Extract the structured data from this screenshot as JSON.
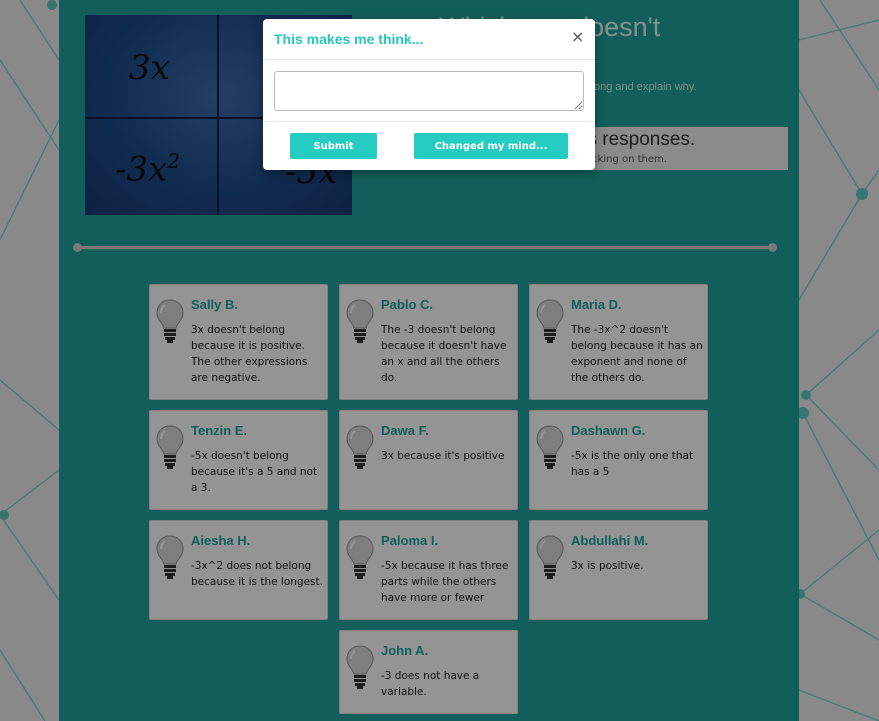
{
  "page": {
    "title": "Which one doesn't",
    "instructions": "Choose the one that doesn't belong and explain why.",
    "intro_heading": "Teacher animates responses.",
    "intro_sub": "You can see their ideas by clicking on them.",
    "expressions": [
      "3x",
      "-3x",
      "-5x",
      "2"
    ]
  },
  "responses": [
    {
      "name": "Sally B.",
      "text": "3x doesn't belong because it is positive. The other expressions are negative."
    },
    {
      "name": "Pablo C.",
      "text": "The -3 doesn't belong because it doesn't have an x and all the others do."
    },
    {
      "name": "Maria D.",
      "text": "The -3x^2 doesn't belong because it has an exponent and none of the others do."
    },
    {
      "name": "Tenzin E.",
      "text": "-5x doesn't belong because it's a 5 and not a 3."
    },
    {
      "name": "Dawa F.",
      "text": "3x because it's positive"
    },
    {
      "name": "Dashawn G.",
      "text": "-5x is the only one that has a 5"
    },
    {
      "name": "Aiesha H.",
      "text": "-3x^2 does not belong because it is the longest."
    },
    {
      "name": "Paloma I.",
      "text": "-5x because it has three parts while the others have more or fewer"
    },
    {
      "name": "Abdullahi M.",
      "text": "3x is positive."
    },
    {
      "name": "John A.",
      "text": "-3 does not have a variable."
    }
  ],
  "modal": {
    "title": "This makes me think...",
    "close_icon": "×",
    "textarea_value": "",
    "submit_label": "Submit",
    "changed_label": "Changed my mind..."
  },
  "colors": {
    "accent": "#26c6bd",
    "panel": "#1fa39b",
    "card": "#ffffff"
  },
  "icons": [
    "lightbulb-icon",
    "close-icon"
  ]
}
